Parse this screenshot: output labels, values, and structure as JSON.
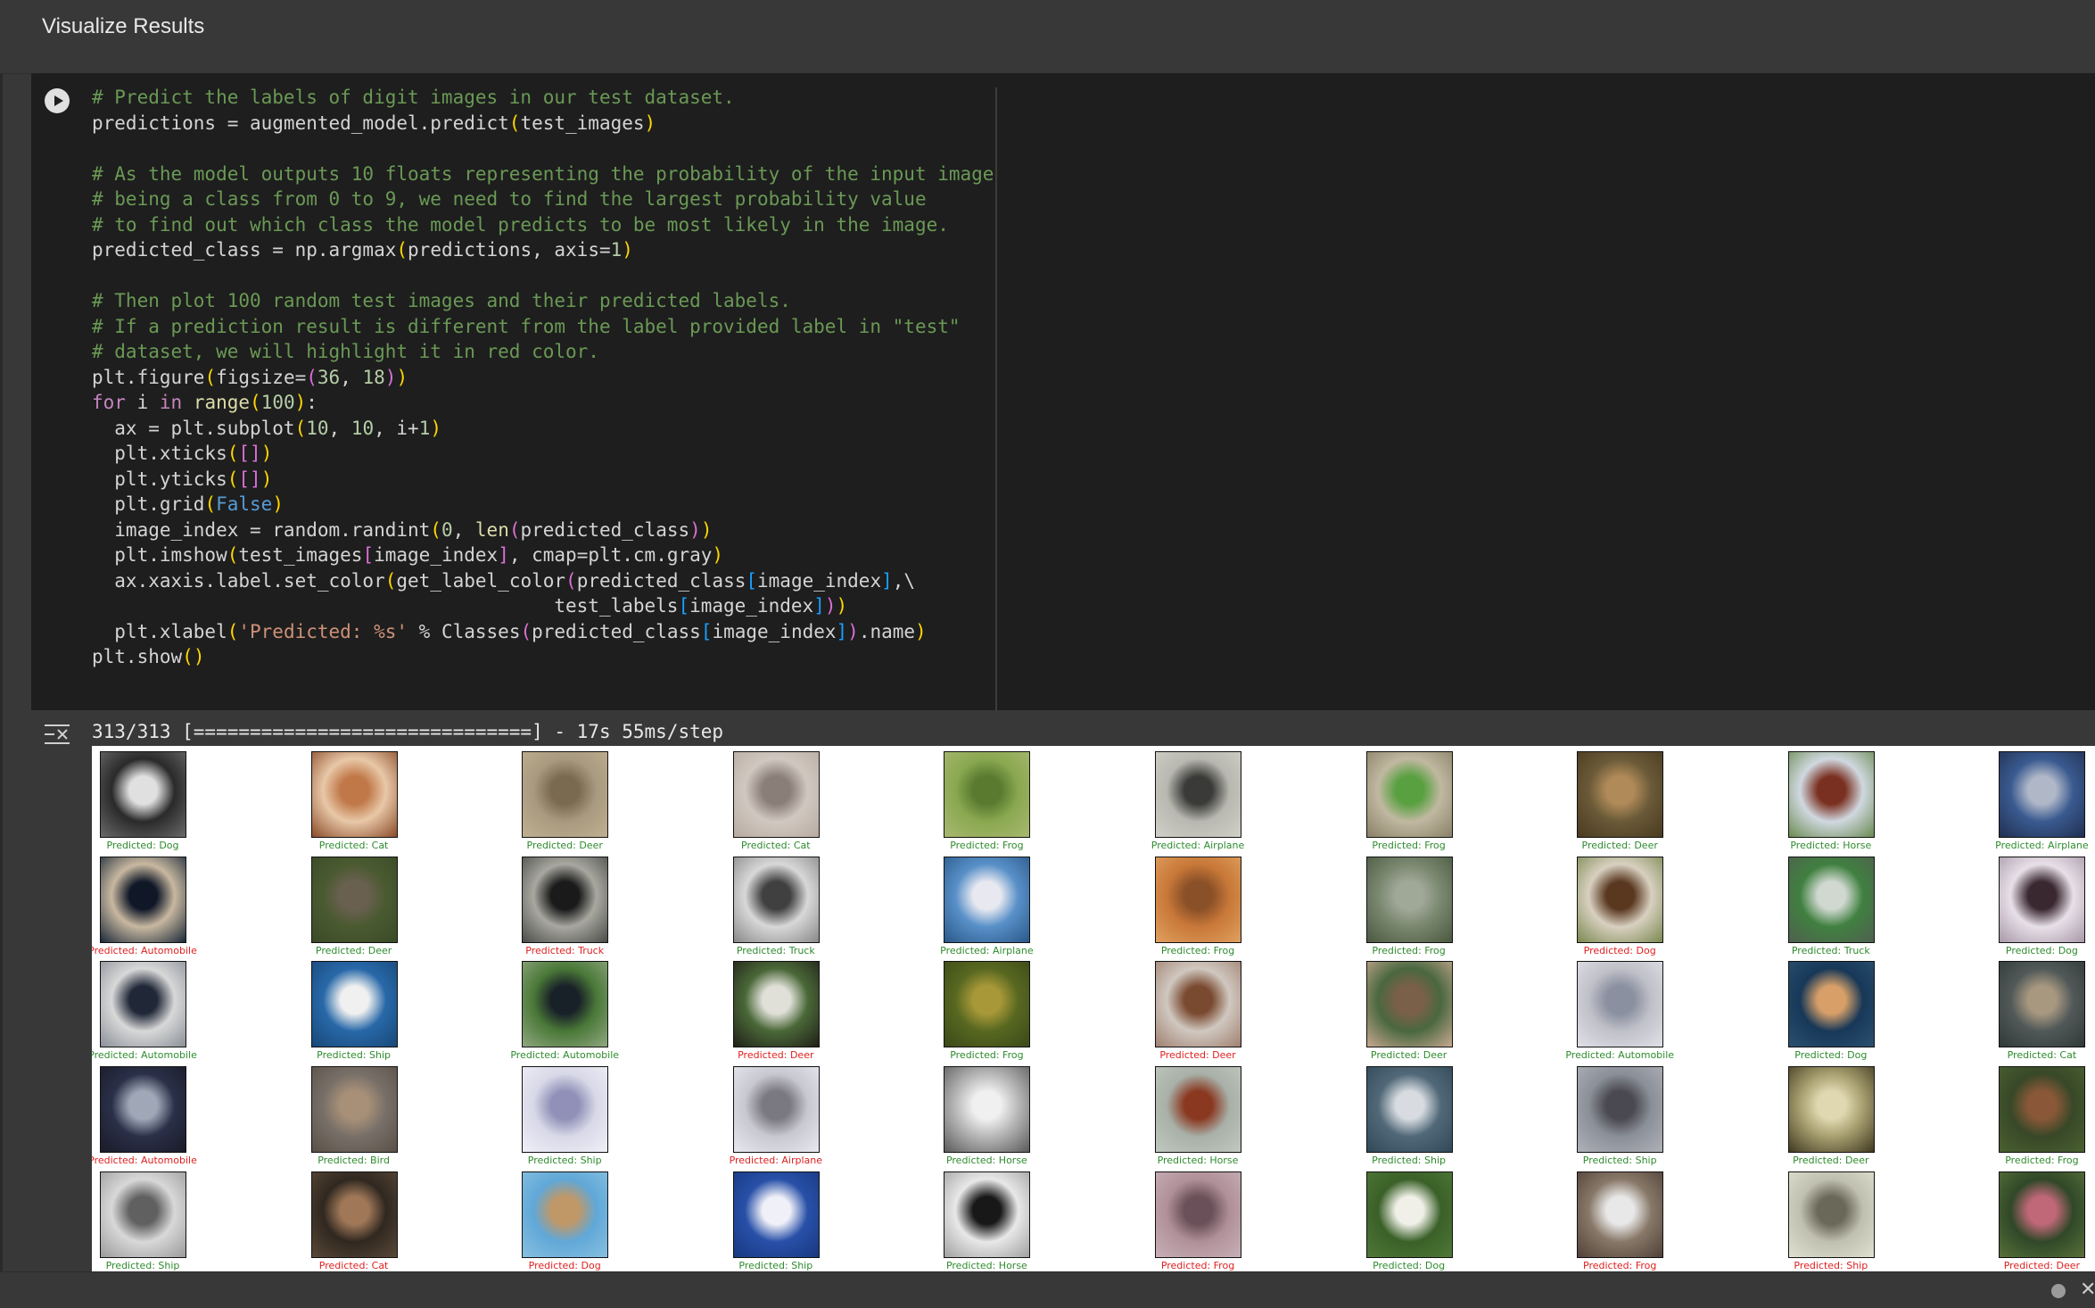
{
  "section": {
    "title": "Visualize Results"
  },
  "code": {
    "lines": [
      [
        [
          "# Predict the labels of digit images in our test dataset.",
          "com"
        ]
      ],
      [
        [
          "predictions = augmented_model.predict",
          ""
        ],
        [
          "(",
          "p1"
        ],
        [
          "test_images",
          ""
        ],
        [
          ")",
          "p1"
        ]
      ],
      [],
      [
        [
          "# As the model outputs 10 floats representing the probability of the input image",
          "com"
        ]
      ],
      [
        [
          "# being a class from 0 to 9, we need to find the largest probability value",
          "com"
        ]
      ],
      [
        [
          "# to find out which class the model predicts to be most likely in the image.",
          "com"
        ]
      ],
      [
        [
          "predicted_class = np.argmax",
          ""
        ],
        [
          "(",
          "p1"
        ],
        [
          "predictions, axis=",
          ""
        ],
        [
          "1",
          "num"
        ],
        [
          ")",
          "p1"
        ]
      ],
      [],
      [
        [
          "# Then plot 100 random test images and their predicted labels.",
          "com"
        ]
      ],
      [
        [
          "# If a prediction result is different from the label provided label in \"test\"",
          "com"
        ]
      ],
      [
        [
          "# dataset, we will highlight it in red color.",
          "com"
        ]
      ],
      [
        [
          "plt.figure",
          ""
        ],
        [
          "(",
          "p1"
        ],
        [
          "figsize=",
          ""
        ],
        [
          "(",
          "p2"
        ],
        [
          "36",
          "num"
        ],
        [
          ", ",
          ""
        ],
        [
          "18",
          "num"
        ],
        [
          ")",
          "p2"
        ],
        [
          ")",
          "p1"
        ]
      ],
      [
        [
          "for",
          "kw"
        ],
        [
          " i ",
          ""
        ],
        [
          "in",
          "kw"
        ],
        [
          " ",
          ""
        ],
        [
          "range",
          "bi"
        ],
        [
          "(",
          "p1"
        ],
        [
          "100",
          "num"
        ],
        [
          ")",
          "p1"
        ],
        [
          ":",
          ""
        ]
      ],
      [
        [
          "  ax = plt.subplot",
          ""
        ],
        [
          "(",
          "p1"
        ],
        [
          "10",
          "num"
        ],
        [
          ", ",
          ""
        ],
        [
          "10",
          "num"
        ],
        [
          ", i+",
          ""
        ],
        [
          "1",
          "num"
        ],
        [
          ")",
          "p1"
        ]
      ],
      [
        [
          "  plt.xticks",
          ""
        ],
        [
          "(",
          "p1"
        ],
        [
          "[",
          "p2"
        ],
        [
          "]",
          "p2"
        ],
        [
          ")",
          "p1"
        ]
      ],
      [
        [
          "  plt.yticks",
          ""
        ],
        [
          "(",
          "p1"
        ],
        [
          "[",
          "p2"
        ],
        [
          "]",
          "p2"
        ],
        [
          ")",
          "p1"
        ]
      ],
      [
        [
          "  plt.grid",
          ""
        ],
        [
          "(",
          "p1"
        ],
        [
          "False",
          "const"
        ],
        [
          ")",
          "p1"
        ]
      ],
      [
        [
          "  image_index = random.randint",
          ""
        ],
        [
          "(",
          "p1"
        ],
        [
          "0",
          "num"
        ],
        [
          ", ",
          ""
        ],
        [
          "len",
          "bi"
        ],
        [
          "(",
          "p2"
        ],
        [
          "predicted_class",
          ""
        ],
        [
          ")",
          "p2"
        ],
        [
          ")",
          "p1"
        ]
      ],
      [
        [
          "  plt.imshow",
          ""
        ],
        [
          "(",
          "p1"
        ],
        [
          "test_images",
          ""
        ],
        [
          "[",
          "p2"
        ],
        [
          "image_index",
          ""
        ],
        [
          "]",
          "p2"
        ],
        [
          ", cmap=plt.cm.gray",
          ""
        ],
        [
          ")",
          "p1"
        ]
      ],
      [
        [
          "  ax.xaxis.label.set_color",
          ""
        ],
        [
          "(",
          "p1"
        ],
        [
          "get_label_color",
          ""
        ],
        [
          "(",
          "p2"
        ],
        [
          "predicted_class",
          ""
        ],
        [
          "[",
          "p3"
        ],
        [
          "image_index",
          ""
        ],
        [
          "]",
          "p3"
        ],
        [
          ",\\",
          ""
        ]
      ],
      [
        [
          "                                         test_labels",
          ""
        ],
        [
          "[",
          "p3"
        ],
        [
          "image_index",
          ""
        ],
        [
          "]",
          "p3"
        ],
        [
          ")",
          "p2"
        ],
        [
          ")",
          "p1"
        ]
      ],
      [
        [
          "  plt.xlabel",
          ""
        ],
        [
          "(",
          "p1"
        ],
        [
          "'Predicted: %s'",
          "str"
        ],
        [
          " % Classes",
          ""
        ],
        [
          "(",
          "p2"
        ],
        [
          "predicted_class",
          ""
        ],
        [
          "[",
          "p3"
        ],
        [
          "image_index",
          ""
        ],
        [
          "]",
          "p3"
        ],
        [
          ")",
          "p2"
        ],
        [
          ".name",
          ""
        ],
        [
          ")",
          "p1"
        ]
      ],
      [
        [
          "plt.show",
          ""
        ],
        [
          "(",
          "p1"
        ],
        [
          ")",
          "p1"
        ]
      ]
    ]
  },
  "output": {
    "progress": "313/313 [==============================] - 17s 55ms/step"
  },
  "grid": {
    "rows": [
      [
        {
          "label": "Predicted: Dog",
          "ok": true,
          "c": [
            "#2a2a2a",
            "#e0e0e0",
            "#6a6a6a"
          ]
        },
        {
          "label": "Predicted: Cat",
          "ok": true,
          "c": [
            "#e8c8a8",
            "#c07848",
            "#8a4a28"
          ]
        },
        {
          "label": "Predicted: Deer",
          "ok": true,
          "c": [
            "#a89a80",
            "#7a6a50",
            "#c0b090"
          ]
        },
        {
          "label": "Predicted: Cat",
          "ok": true,
          "c": [
            "#d0c8c0",
            "#8a7e78",
            "#b8aaa0"
          ]
        },
        {
          "label": "Predicted: Frog",
          "ok": true,
          "c": [
            "#8aa850",
            "#5a7a30",
            "#a8b870"
          ]
        },
        {
          "label": "Predicted: Airplane",
          "ok": true,
          "c": [
            "#b8b8b0",
            "#3a3a38",
            "#d0d0c8"
          ]
        },
        {
          "label": "Predicted: Frog",
          "ok": true,
          "c": [
            "#c0b8a0",
            "#58a040",
            "#8a8068"
          ]
        },
        {
          "label": "Predicted: Deer",
          "ok": true,
          "c": [
            "#6a5a38",
            "#b08a58",
            "#4a3a20"
          ]
        },
        {
          "label": "Predicted: Horse",
          "ok": true,
          "c": [
            "#d0d8e0",
            "#7a3020",
            "#6a8a50"
          ]
        },
        {
          "label": "Predicted: Airplane",
          "ok": true,
          "c": [
            "#3a5a90",
            "#b0b8c8",
            "#203050"
          ]
        }
      ],
      [
        {
          "label": "Predicted: Automobile",
          "ok": false,
          "c": [
            "#c8b8a0",
            "#101828",
            "#1a2838"
          ]
        },
        {
          "label": "Predicted: Deer",
          "ok": true,
          "c": [
            "#4a5a30",
            "#6a6050",
            "#3a4a28"
          ]
        },
        {
          "label": "Predicted: Truck",
          "ok": false,
          "c": [
            "#a8a8a0",
            "#1a1a1a",
            "#4a4a48"
          ]
        },
        {
          "label": "Predicted: Truck",
          "ok": true,
          "c": [
            "#d8d8d8",
            "#404040",
            "#888888"
          ]
        },
        {
          "label": "Predicted: Airplane",
          "ok": true,
          "c": [
            "#5890c8",
            "#e8e8f0",
            "#2a5888"
          ]
        },
        {
          "label": "Predicted: Frog",
          "ok": true,
          "c": [
            "#c87838",
            "#8a5028",
            "#e0a060"
          ]
        },
        {
          "label": "Predicted: Frog",
          "ok": true,
          "c": [
            "#7a8870",
            "#a0a898",
            "#4a5840"
          ]
        },
        {
          "label": "Predicted: Dog",
          "ok": false,
          "c": [
            "#d8d0c0",
            "#5a3820",
            "#7a8850"
          ]
        },
        {
          "label": "Predicted: Truck",
          "ok": true,
          "c": [
            "#408040",
            "#d0d8d0",
            "#506050"
          ]
        },
        {
          "label": "Predicted: Dog",
          "ok": true,
          "c": [
            "#e8e0e8",
            "#3a2830",
            "#a898a8"
          ]
        }
      ],
      [
        {
          "label": "Predicted: Automobile",
          "ok": true,
          "c": [
            "#d8d8d8",
            "#202838",
            "#8a9098"
          ]
        },
        {
          "label": "Predicted: Ship",
          "ok": true,
          "c": [
            "#2868a8",
            "#f0f0f0",
            "#184878"
          ]
        },
        {
          "label": "Predicted: Automobile",
          "ok": true,
          "c": [
            "#4a7838",
            "#182028",
            "#90a880"
          ]
        },
        {
          "label": "Predicted: Deer",
          "ok": false,
          "c": [
            "#4a6838",
            "#e0e0d8",
            "#202018"
          ]
        },
        {
          "label": "Predicted: Frog",
          "ok": true,
          "c": [
            "#586820",
            "#a89838",
            "#3a4818"
          ]
        },
        {
          "label": "Predicted: Deer",
          "ok": false,
          "c": [
            "#d0c8c0",
            "#7a4a30",
            "#a08070"
          ]
        },
        {
          "label": "Predicted: Deer",
          "ok": true,
          "c": [
            "#4a6840",
            "#7a6048",
            "#c8a890"
          ]
        },
        {
          "label": "Predicted: Automobile",
          "ok": true,
          "c": [
            "#c0c0c8",
            "#8a90a0",
            "#e0e0e8"
          ]
        },
        {
          "label": "Predicted: Dog",
          "ok": true,
          "c": [
            "#183858",
            "#d8a068",
            "#2a5070"
          ]
        },
        {
          "label": "Predicted: Cat",
          "ok": true,
          "c": [
            "#505858",
            "#a89880",
            "#303838"
          ]
        }
      ],
      [
        {
          "label": "Predicted: Automobile",
          "ok": false,
          "c": [
            "#2a3048",
            "#a0a8b8",
            "#1a1a28"
          ]
        },
        {
          "label": "Predicted: Bird",
          "ok": true,
          "c": [
            "#787068",
            "#a89078",
            "#5a5048"
          ]
        },
        {
          "label": "Predicted: Ship",
          "ok": true,
          "c": [
            "#d8d8e8",
            "#9090b8",
            "#f0f0f8"
          ]
        },
        {
          "label": "Predicted: Airplane",
          "ok": false,
          "c": [
            "#c8c8d0",
            "#7a7880",
            "#e8e8f0"
          ]
        },
        {
          "label": "Predicted: Horse",
          "ok": true,
          "c": [
            "#b8b8b8",
            "#f0f0f0",
            "#5a5a5a"
          ]
        },
        {
          "label": "Predicted: Horse",
          "ok": true,
          "c": [
            "#a8b0a8",
            "#8a3820",
            "#c0c8c0"
          ]
        },
        {
          "label": "Predicted: Ship",
          "ok": true,
          "c": [
            "#506878",
            "#d8dce0",
            "#304858"
          ]
        },
        {
          "label": "Predicted: Ship",
          "ok": true,
          "c": [
            "#8a9098",
            "#4a4850",
            "#b0b0b8"
          ]
        },
        {
          "label": "Predicted: Deer",
          "ok": true,
          "c": [
            "#a8a070",
            "#e0d8b0",
            "#403820"
          ]
        },
        {
          "label": "Predicted: Frog",
          "ok": true,
          "c": [
            "#384828",
            "#8a5838",
            "#4a6030"
          ]
        }
      ],
      [
        {
          "label": "Predicted: Ship",
          "ok": true,
          "c": [
            "#d8d8d8",
            "#606060",
            "#9a9a9a"
          ]
        },
        {
          "label": "Predicted: Cat",
          "ok": false,
          "c": [
            "#302820",
            "#a07858",
            "#5a4838"
          ]
        },
        {
          "label": "Predicted: Dog",
          "ok": false,
          "c": [
            "#60a8d8",
            "#c09868",
            "#88c0e0"
          ]
        },
        {
          "label": "Predicted: Ship",
          "ok": true,
          "c": [
            "#2850a8",
            "#f0f0f8",
            "#183880"
          ]
        },
        {
          "label": "Predicted: Horse",
          "ok": true,
          "c": [
            "#e8e8e8",
            "#181818",
            "#a0a0a0"
          ]
        },
        {
          "label": "Predicted: Frog",
          "ok": false,
          "c": [
            "#b09098",
            "#6a5058",
            "#c8b0b8"
          ]
        },
        {
          "label": "Predicted: Dog",
          "ok": true,
          "c": [
            "#3a6028",
            "#f0f0e8",
            "#507838"
          ]
        },
        {
          "label": "Predicted: Frog",
          "ok": false,
          "c": [
            "#887868",
            "#e8e8e8",
            "#504038"
          ]
        },
        {
          "label": "Predicted: Ship",
          "ok": false,
          "c": [
            "#c0c0b0",
            "#6a6858",
            "#e0e0d0"
          ]
        },
        {
          "label": "Predicted: Deer",
          "ok": false,
          "c": [
            "#304828",
            "#c06878",
            "#587038"
          ]
        }
      ]
    ]
  }
}
